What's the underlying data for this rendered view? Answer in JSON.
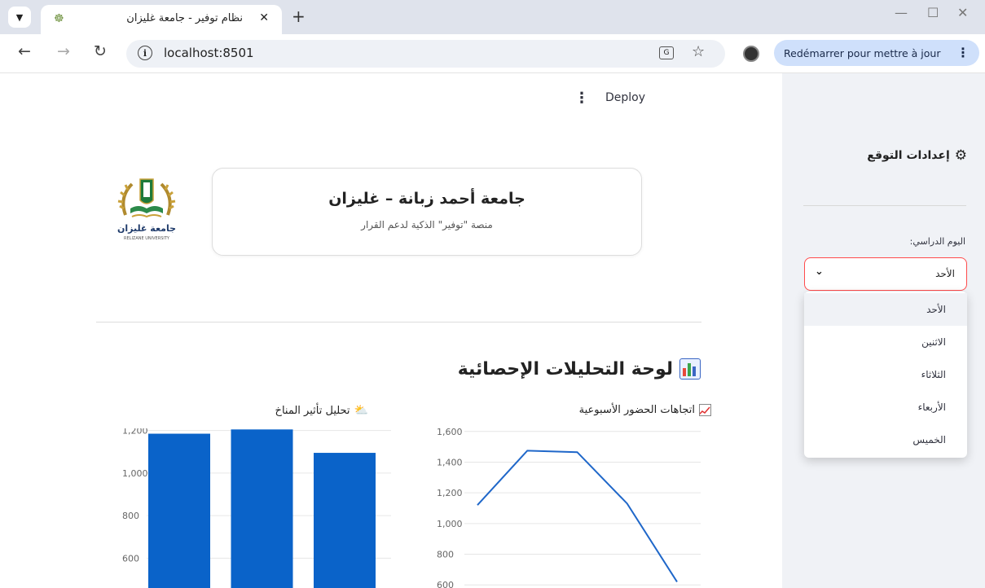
{
  "browser": {
    "tab_title": "نظام توفير - جامعة غليزان",
    "tab_close": "✕",
    "new_tab": "+",
    "url": "localhost:8501",
    "update_button": "Redémarrer pour mettre à jour",
    "window_controls": [
      "—",
      "☐",
      "✕"
    ]
  },
  "app": {
    "deploy_label": "Deploy",
    "menu_icon": "⋮",
    "university_name": "جامعة أحمد زبانة – غليزان",
    "platform_subtitle": "منصة \"توفير\" الذكية لدعم القرار",
    "logo_text": "جامعة غليزان",
    "logo_subtext": "RELIZANE UNIVERSITY",
    "dashboard_title": "لوحة التحليلات الإحصائية"
  },
  "sidebar": {
    "settings_title": "إعدادات التوقع",
    "day_label": "اليوم الدراسي:",
    "selected_day": "الأحد",
    "options": [
      "الأحد",
      "الاثنين",
      "الثلاثاء",
      "الأربعاء",
      "الخميس"
    ]
  },
  "chart_data": [
    {
      "type": "line",
      "title": "اتجاهات الحضور الأسبوعية",
      "y": [
        1120,
        1475,
        1465,
        1130,
        620
      ],
      "ylim": [
        580,
        1620
      ],
      "yticks": [
        "1,600",
        "1,400",
        "1,200",
        "1,000",
        "800",
        "600"
      ],
      "color": "#1f67c9",
      "grid": true
    },
    {
      "type": "bar",
      "title": "تحليل تأثير المناخ",
      "values": [
        1185,
        1205,
        1095
      ],
      "ylim": [
        460,
        1210
      ],
      "yticks": [
        "1,200",
        "1,000",
        "800",
        "600"
      ],
      "color": "#0a63c9",
      "grid": true
    }
  ]
}
